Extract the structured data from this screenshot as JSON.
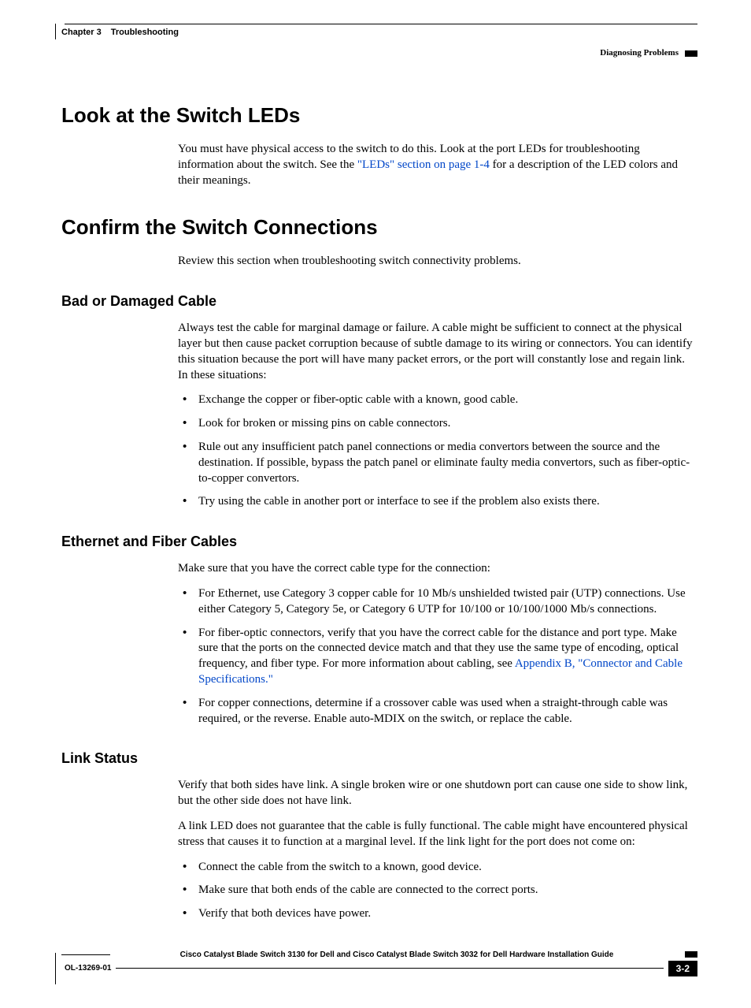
{
  "header": {
    "chapter_label": "Chapter 3",
    "chapter_title": "Troubleshooting",
    "section": "Diagnosing Problems"
  },
  "h1a": "Look at the Switch LEDs",
  "p1a_pre": "You must have physical access to the switch to do this. Look at the port LEDs for troubleshooting information about the switch. See the ",
  "p1a_link": "\"LEDs\" section on page 1-4",
  "p1a_post": " for a description of the LED colors and their meanings.",
  "h1b": "Confirm the Switch Connections",
  "p1b": "Review this section when troubleshooting switch connectivity problems.",
  "h2a": "Bad or Damaged Cable",
  "p2a": "Always test the cable for marginal damage or failure. A cable might be sufficient to connect at the physical layer but then cause packet corruption because of subtle damage to its wiring or connectors. You can identify this situation because the port will have many packet errors, or the port will constantly lose and regain link. In these situations:",
  "list_a": {
    "0": "Exchange the copper or fiber-optic cable with a known, good cable.",
    "1": "Look for broken or missing pins on cable connectors.",
    "2": "Rule out any insufficient patch panel connections or media convertors between the source and the destination. If possible, bypass the patch panel or eliminate faulty media convertors, such as fiber-optic-to-copper convertors.",
    "3": "Try using the cable in another port or interface to see if the problem also exists there."
  },
  "h2b": "Ethernet and Fiber Cables",
  "p2b": "Make sure that you have the correct cable type for the connection:",
  "list_b": {
    "0": "For Ethernet, use Category 3 copper cable for 10 Mb/s unshielded twisted pair (UTP) connections. Use either Category 5, Category 5e, or Category 6 UTP for 10/100 or 10/100/1000 Mb/s connections.",
    "1_pre": "For fiber-optic connectors, verify that you have the correct cable for the distance and port type. Make sure that the ports on the connected device match and that they use the same type of encoding, optical frequency, and fiber type. For more information about cabling, see ",
    "1_link": "Appendix B, \"Connector and Cable Specifications.\"",
    "2": "For copper connections, determine if a crossover cable was used when a straight-through cable was required, or the reverse. Enable auto-MDIX on the switch, or replace the cable."
  },
  "h2c": "Link Status",
  "p2c1": "Verify that both sides have link. A single broken wire or one shutdown port can cause one side to show link, but the other side does not have link.",
  "p2c2": "A link LED does not guarantee that the cable is fully functional. The cable might have encountered physical stress that causes it to function at a marginal level. If the link light for the port does not come on:",
  "list_c": {
    "0": "Connect the cable from the switch to a known, good device.",
    "1": "Make sure that both ends of the cable are connected to the correct ports.",
    "2": "Verify that both devices have power."
  },
  "footer": {
    "title": "Cisco Catalyst Blade Switch 3130 for Dell and Cisco Catalyst Blade Switch 3032 for Dell Hardware Installation Guide",
    "ol": "OL-13269-01",
    "page": "3-2"
  }
}
